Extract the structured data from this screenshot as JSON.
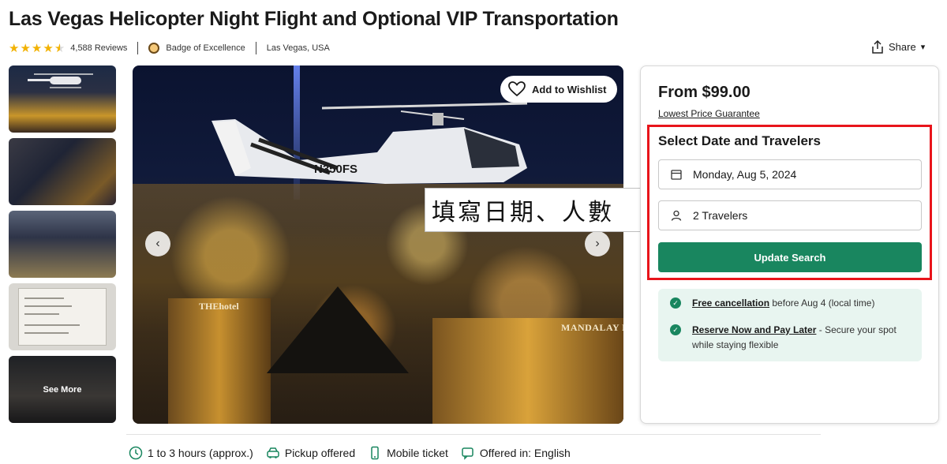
{
  "header": {
    "title": "Las Vegas Helicopter Night Flight and Optional VIP Transportation",
    "reviews": "4,588 Reviews",
    "badge": "Badge of Excellence",
    "location": "Las Vegas, USA",
    "share_label": "Share",
    "rating_stars": 4.5
  },
  "gallery": {
    "see_more": "See More",
    "wishlist_label": "Add to Wishlist",
    "hero_signs": {
      "the_hotel": "THEhotel",
      "mandalay": "MANDALAY B",
      "heli_reg": "N350FS"
    }
  },
  "annotation": {
    "text": "填寫日期、人數"
  },
  "booking": {
    "price": "From $99.00",
    "guarantee": "Lowest Price Guarantee",
    "section_title": "Select Date and Travelers",
    "date_value": "Monday, Aug 5, 2024",
    "travelers_value": "2 Travelers",
    "update_button": "Update Search",
    "benefits": {
      "cancel_link": "Free cancellation",
      "cancel_rest": " before Aug 4 (local time)",
      "reserve_link": "Reserve Now and Pay Later",
      "reserve_rest": " - Secure your spot while staying flexible"
    }
  },
  "features": {
    "duration": "1 to 3 hours (approx.)",
    "pickup": "Pickup offered",
    "ticket": "Mobile ticket",
    "language": "Offered in: English"
  },
  "colors": {
    "accent_green": "#19865f",
    "star_yellow": "#f2b203",
    "highlight_red": "#e8141b"
  }
}
